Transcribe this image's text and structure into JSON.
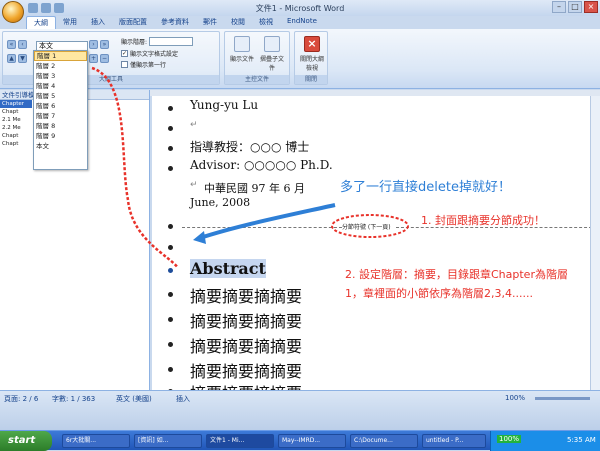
{
  "window": {
    "title": "文件1 - Microsoft Word"
  },
  "tabs": [
    "大綱",
    "常用",
    "插入",
    "版面配置",
    "參考資料",
    "郵件",
    "校閱",
    "檢視",
    "EndNote"
  ],
  "ribbon": {
    "level_select_value": "本文",
    "show_level_label": "顯示階層:",
    "show_text_format_label": "顯示文字格式設定",
    "show_first_line_label": "僅顯示第一行",
    "show_document_label": "顯示文件",
    "collapse_subdocs_label": "摺疊子文件",
    "close_outline_label": "關閉大綱檢視",
    "group_master": "主控文件",
    "group_close": "關閉",
    "group_tools": "大綱工具"
  },
  "dropdown": {
    "items": [
      "階層 1",
      "階層 2",
      "階層 3",
      "階層 4",
      "階層 5",
      "階層 6",
      "階層 7",
      "階層 8",
      "階層 9",
      "本文"
    ],
    "selected_index": 0
  },
  "left_pane": {
    "title": "文件引導模式",
    "items": [
      "Chapter",
      "Chapt",
      "2.1 Me",
      "2.2 Me",
      "Chapt",
      "Chapt"
    ]
  },
  "document": {
    "lines": [
      "Yung-yu Lu",
      "",
      "指導教授：○○○  博士",
      "Advisor:  ○○○○○  Ph.D.",
      "",
      "中華民國 97 年 6 月",
      "June, 2008",
      "",
      "",
      "Abstract",
      "摘要摘要摘摘要",
      "摘要摘要摘摘要",
      "摘要摘要摘摘要",
      "摘要摘要摘摘要",
      "摘要摘要摘摘要"
    ],
    "section_break_label": "分節符號 (下一頁)"
  },
  "annotations": {
    "blue_note": "多了一行直接delete掉就好！",
    "red_note_1": "1. 封面跟摘要分節成功！",
    "red_note_2": "2. 設定階層：摘要，目錄跟章Chapter為階層1，章裡面的小節依序為階層2,3,4......"
  },
  "status_bar": {
    "page": "頁面: 2 / 6",
    "words": "字數: 1 / 363",
    "language": "英文 (美國)",
    "mode": "插入",
    "zoom": "100%"
  },
  "taskbar": {
    "start": "start",
    "tasks": [
      "6r大批關...",
      "[資訊] 如...",
      "文件1 - Mi...",
      "May--IMRD...",
      "C:\\Docume...",
      "untitled - P..."
    ],
    "tray_percent": "100%",
    "clock": "5:35 AM"
  },
  "colors": {
    "red_note": "#e8322a",
    "blue_note": "#2e7fd6"
  }
}
